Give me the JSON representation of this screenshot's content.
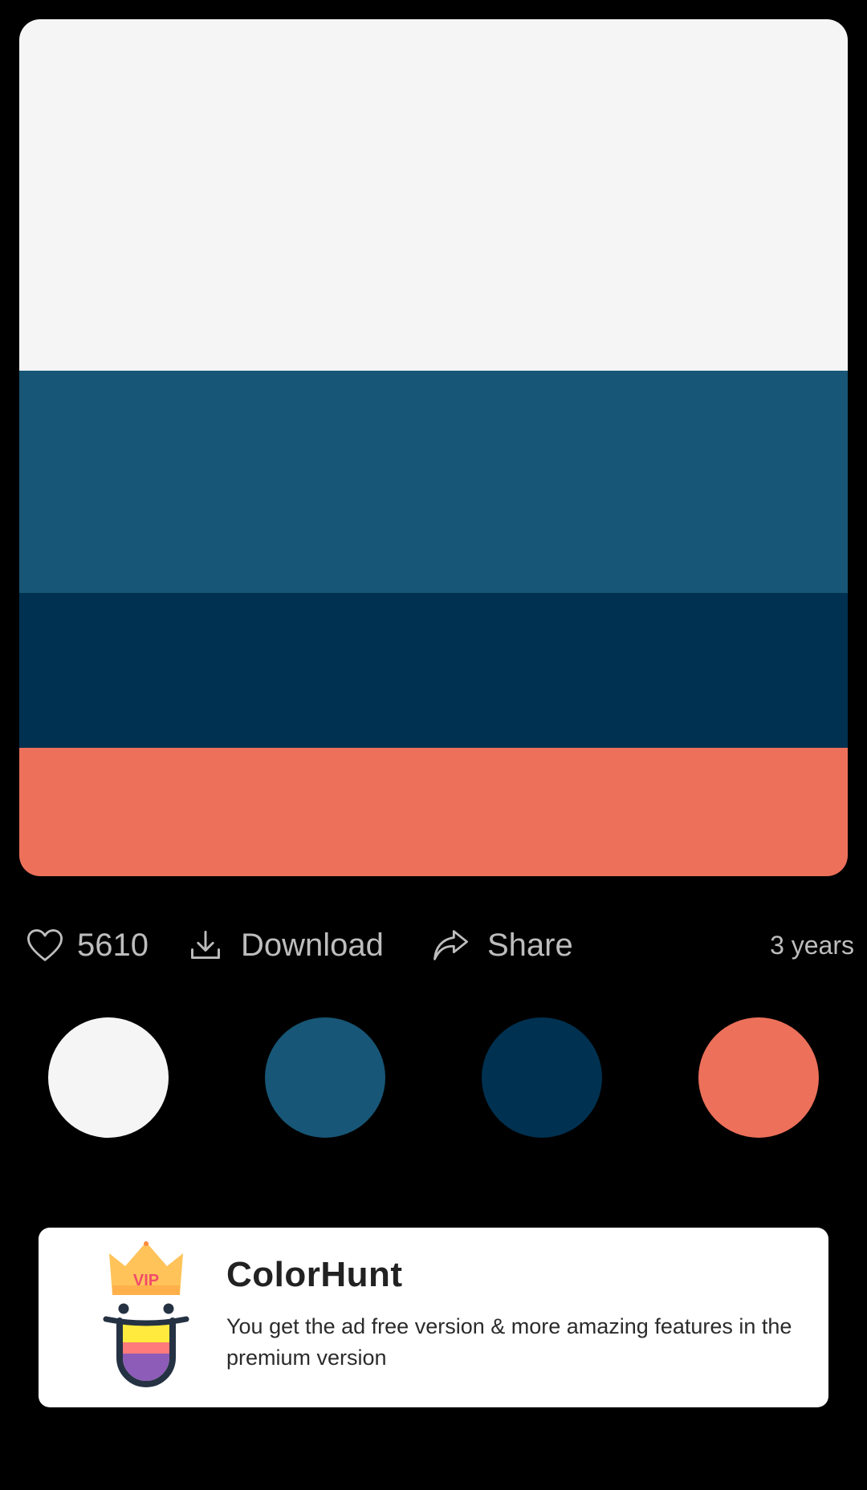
{
  "palette": {
    "colors": [
      "#F5F5F5",
      "#175676",
      "#003150",
      "#EC705A"
    ]
  },
  "actions": {
    "likes_count": "5610",
    "download_label": "Download",
    "share_label": "Share",
    "age": "3 years"
  },
  "icons": {
    "like": "heart-icon",
    "download": "download-icon",
    "share": "share-arrow-icon",
    "promo_logo": "colorhunt-vip-logo"
  },
  "promo": {
    "title": "ColorHunt",
    "description": "You get the ad free version & more amazing features in the premium version",
    "logo_badge_text": "VIP"
  }
}
